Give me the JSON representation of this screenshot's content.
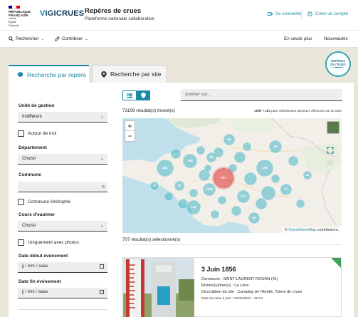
{
  "header": {
    "republic": [
      "RÉPUBLIQUE",
      "FRANÇAISE"
    ],
    "motto": [
      "Liberté",
      "Égalité",
      "Fraternité"
    ],
    "brand_prefix": "V",
    "brand_rest": "IGICRUES",
    "site_title": "Repères de crues",
    "site_subtitle": "Plateforme nationale collaborative",
    "login_label": "Se connecter",
    "register_label": "Créer un compte"
  },
  "nav": {
    "search_label": "Rechercher",
    "contribute_label": "Contribuer",
    "more_label": "En savoir plus",
    "news_label": "Nouveautés"
  },
  "badge": {
    "line1": "REPÈRES",
    "line2": "DE CRUES"
  },
  "tabs": [
    {
      "label": "Recherche par repère",
      "active": true
    },
    {
      "label": "Recherche par site",
      "active": false
    }
  ],
  "filters": {
    "unit_label": "Unité de gestion",
    "unit_value": "Indifférent",
    "near_me_label": "Autour de moi",
    "department_label": "Département",
    "department_value": "Choisir",
    "commune_label": "Commune",
    "commune_value": "",
    "commune_border_label": "Commune limitrophe",
    "river_label": "Cours d'eau/mer",
    "river_value": "Choisir",
    "photos_label": "Uniquement avec photos",
    "start_date_label": "Date début événement",
    "start_date_placeholder": "jj / mm / aaaa",
    "end_date_label": "Date fin événement",
    "end_date_placeholder": "jj / mm / aaaa"
  },
  "toolbar": {
    "zoom_placeholder": "zoomer sur...",
    "result_count": "73109 résultat(s) trouvé(s)",
    "shift_hint_key": "shift + clic",
    "shift_hint_rest": " pour sélectionner plusieurs éléments sur la carte",
    "selected_count": "707 résultat(s) sélectionné(s)"
  },
  "map": {
    "zoom_in": "+",
    "zoom_out": "−",
    "attribution_symbol": "©",
    "attribution_link": "OpenStreetMap",
    "attribution_rest": " contributors.",
    "clusters": [
      {
        "label": "707",
        "selected": true
      },
      {
        "label": "1276"
      },
      {
        "label": "241"
      },
      {
        "label": "166"
      },
      {
        "label": "145"
      },
      {
        "label": "137"
      },
      {
        "label": "129"
      },
      {
        "label": "94"
      },
      {
        "label": "63"
      },
      {
        "label": "57"
      },
      {
        "label": "33"
      },
      {
        "label": "25"
      },
      {
        "label": "19"
      },
      {
        "label": "12"
      },
      {
        "label": "9"
      }
    ]
  },
  "card": {
    "title": "3 Juin 1856",
    "commune": "Commune : SAINT-LAURENT-NOUAN (41)",
    "river": "Rivière(s)/mer(s) : La Loire",
    "site": "Description du site : Camping de l'Amitié, Totem de crues",
    "updated": "Date de mise à jour : 12/02/2022 - 22:13"
  },
  "colors": {
    "accent": "#1a8aa6",
    "cluster": "#46b4c4",
    "selected_cluster": "#e0605f",
    "card_corner": "#3aa05a"
  }
}
